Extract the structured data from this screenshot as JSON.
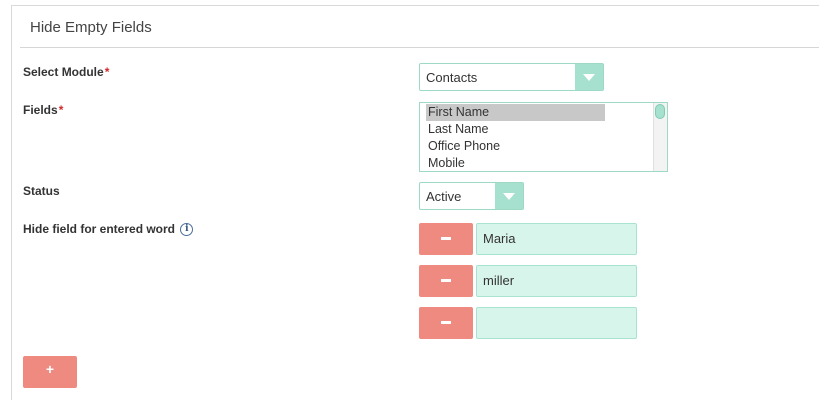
{
  "panel": {
    "title": "Hide Empty Fields"
  },
  "fields": {
    "module": {
      "label": "Select Module",
      "required_mark": "*",
      "value": "Contacts"
    },
    "fields": {
      "label": "Fields",
      "required_mark": "*",
      "options": [
        "First Name",
        "Last Name",
        "Office Phone",
        "Mobile"
      ],
      "selected": "First Name"
    },
    "status": {
      "label": "Status",
      "value": "Active"
    },
    "hide_words": {
      "label": "Hide field for entered word",
      "info_icon": "i",
      "entries": [
        "Maria",
        "miller",
        ""
      ]
    }
  },
  "buttons": {
    "remove_symbol": "−",
    "add_label": "+"
  },
  "colors": {
    "accent_green": "#a6e0cf",
    "input_fill": "#d8f5ec",
    "button_red": "#ef8a80",
    "required": "#d0282c"
  },
  "icons": [
    "dropdown-arrow-icon",
    "info-icon",
    "minus-icon",
    "plus-icon"
  ]
}
